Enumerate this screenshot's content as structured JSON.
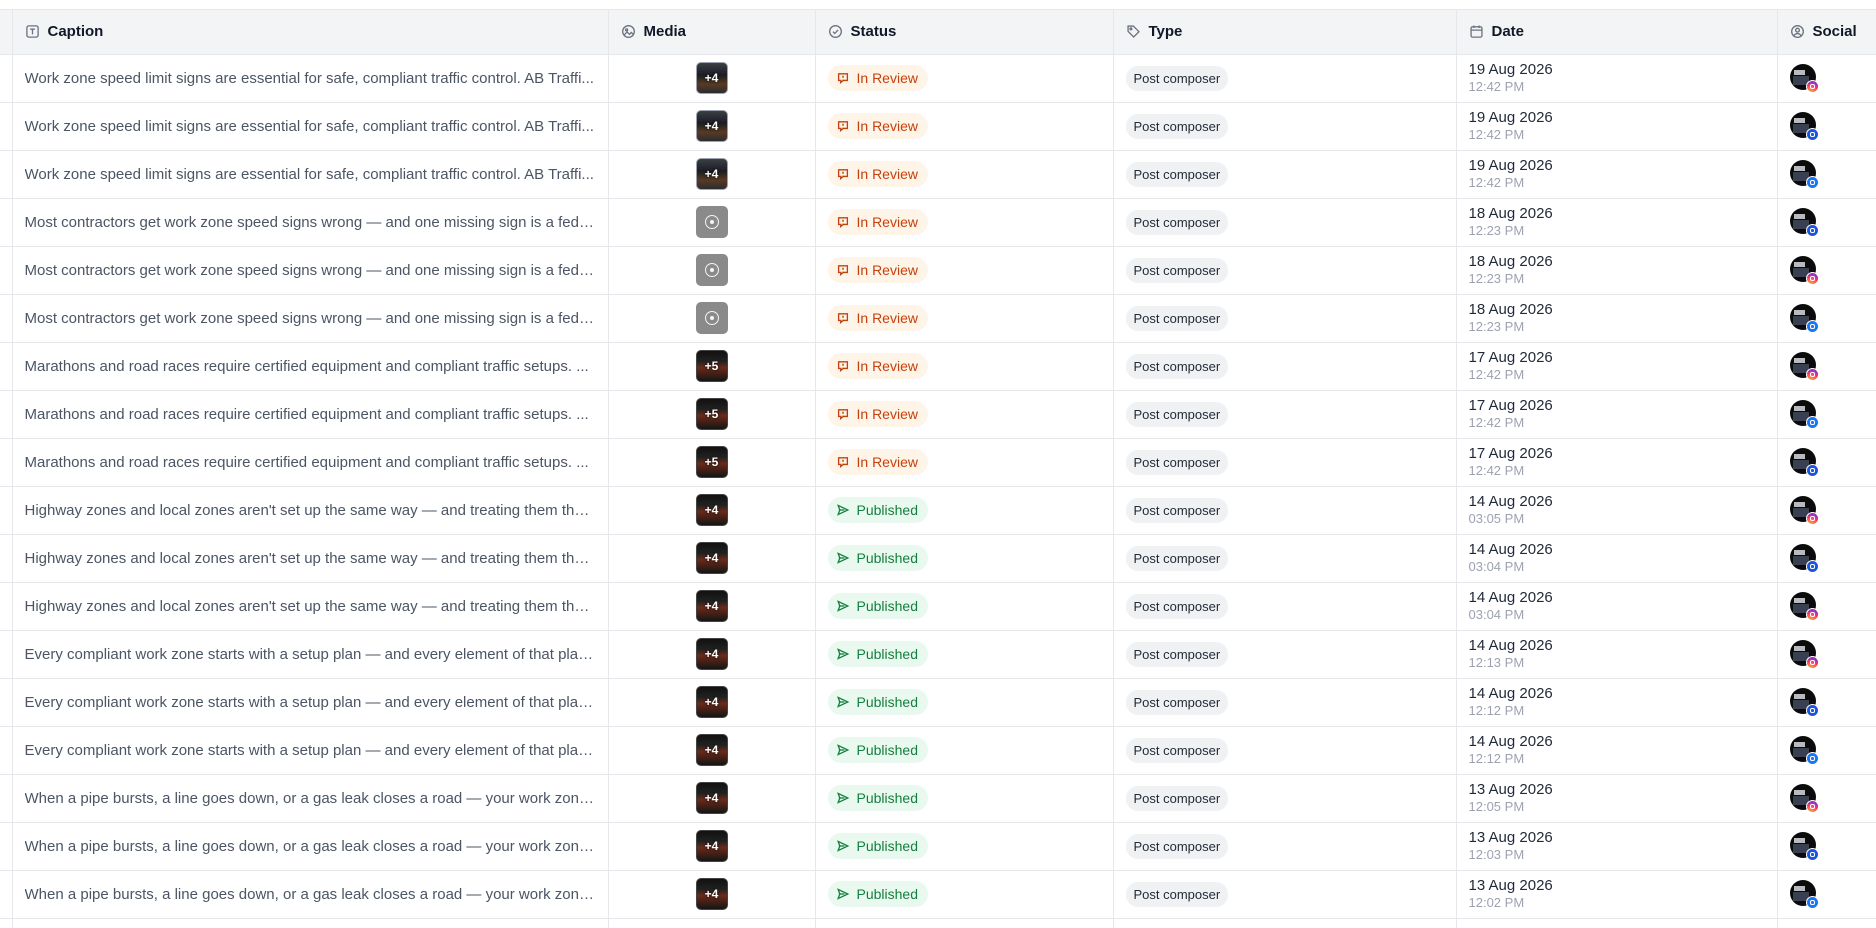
{
  "columns": [
    {
      "key": "caption",
      "label": "Caption",
      "icon": "text-icon"
    },
    {
      "key": "media",
      "label": "Media",
      "icon": "image-icon"
    },
    {
      "key": "status",
      "label": "Status",
      "icon": "check-circle-icon"
    },
    {
      "key": "type",
      "label": "Type",
      "icon": "tag-icon"
    },
    {
      "key": "date",
      "label": "Date",
      "icon": "calendar-icon"
    },
    {
      "key": "social",
      "label": "Social",
      "icon": "user-circle-icon"
    }
  ],
  "colors": {
    "review_text": "#c2410c",
    "review_bg": "#fff4e8",
    "published_text": "#15803d",
    "published_bg": "#e9f9ef"
  },
  "rows": [
    {
      "caption": "Work zone speed limit signs are essential for safe, compliant traffic control. AB Traffi...",
      "media": "+4",
      "media_kind": "image",
      "status": "In Review",
      "status_kind": "review",
      "type": "Post composer",
      "date": "19 Aug 2026",
      "time": "12:42 PM",
      "social": "instagram"
    },
    {
      "caption": "Work zone speed limit signs are essential for safe, compliant traffic control. AB Traffi...",
      "media": "+4",
      "media_kind": "image",
      "status": "In Review",
      "status_kind": "review",
      "type": "Post composer",
      "date": "19 Aug 2026",
      "time": "12:42 PM",
      "social": "gbp"
    },
    {
      "caption": "Work zone speed limit signs are essential for safe, compliant traffic control. AB Traffi...",
      "media": "+4",
      "media_kind": "image",
      "status": "In Review",
      "status_kind": "review",
      "type": "Post composer",
      "date": "19 Aug 2026",
      "time": "12:42 PM",
      "social": "facebook"
    },
    {
      "caption": "Most contractors get work zone speed signs wrong — and one missing sign is a fede...",
      "media": "",
      "media_kind": "video",
      "status": "In Review",
      "status_kind": "review",
      "type": "Post composer",
      "date": "18 Aug 2026",
      "time": "12:23 PM",
      "social": "gbp"
    },
    {
      "caption": "Most contractors get work zone speed signs wrong — and one missing sign is a fede...",
      "media": "",
      "media_kind": "video",
      "status": "In Review",
      "status_kind": "review",
      "type": "Post composer",
      "date": "18 Aug 2026",
      "time": "12:23 PM",
      "social": "instagram"
    },
    {
      "caption": "Most contractors get work zone speed signs wrong — and one missing sign is a fede...",
      "media": "",
      "media_kind": "video",
      "status": "In Review",
      "status_kind": "review",
      "type": "Post composer",
      "date": "18 Aug 2026",
      "time": "12:23 PM",
      "social": "facebook"
    },
    {
      "caption": "Marathons and road races require certified equipment and compliant traffic setups. ...",
      "media": "+5",
      "media_kind": "image-dark",
      "status": "In Review",
      "status_kind": "review",
      "type": "Post composer",
      "date": "17 Aug 2026",
      "time": "12:42 PM",
      "social": "instagram"
    },
    {
      "caption": "Marathons and road races require certified equipment and compliant traffic setups. ...",
      "media": "+5",
      "media_kind": "image-dark",
      "status": "In Review",
      "status_kind": "review",
      "type": "Post composer",
      "date": "17 Aug 2026",
      "time": "12:42 PM",
      "social": "facebook"
    },
    {
      "caption": "Marathons and road races require certified equipment and compliant traffic setups. ...",
      "media": "+5",
      "media_kind": "image-dark",
      "status": "In Review",
      "status_kind": "review",
      "type": "Post composer",
      "date": "17 Aug 2026",
      "time": "12:42 PM",
      "social": "gbp"
    },
    {
      "caption": "Highway zones and local zones aren't set up the same way — and treating them the s...",
      "media": "+4",
      "media_kind": "image-dark",
      "status": "Published",
      "status_kind": "published",
      "type": "Post composer",
      "date": "14 Aug 2026",
      "time": "03:05 PM",
      "social": "instagram"
    },
    {
      "caption": "Highway zones and local zones aren't set up the same way — and treating them the s...",
      "media": "+4",
      "media_kind": "image-dark",
      "status": "Published",
      "status_kind": "published",
      "type": "Post composer",
      "date": "14 Aug 2026",
      "time": "03:04 PM",
      "social": "gbp"
    },
    {
      "caption": "Highway zones and local zones aren't set up the same way — and treating them the s...",
      "media": "+4",
      "media_kind": "image-dark",
      "status": "Published",
      "status_kind": "published",
      "type": "Post composer",
      "date": "14 Aug 2026",
      "time": "03:04 PM",
      "social": "instagram"
    },
    {
      "caption": "Every compliant work zone starts with a setup plan — and every element of that plan ...",
      "media": "+4",
      "media_kind": "image-dark",
      "status": "Published",
      "status_kind": "published",
      "type": "Post composer",
      "date": "14 Aug 2026",
      "time": "12:13 PM",
      "social": "instagram"
    },
    {
      "caption": "Every compliant work zone starts with a setup plan — and every element of that plan ...",
      "media": "+4",
      "media_kind": "image-dark",
      "status": "Published",
      "status_kind": "published",
      "type": "Post composer",
      "date": "14 Aug 2026",
      "time": "12:12 PM",
      "social": "gbp"
    },
    {
      "caption": "Every compliant work zone starts with a setup plan — and every element of that plan ...",
      "media": "+4",
      "media_kind": "image-dark",
      "status": "Published",
      "status_kind": "published",
      "type": "Post composer",
      "date": "14 Aug 2026",
      "time": "12:12 PM",
      "social": "facebook"
    },
    {
      "caption": "When a pipe bursts, a line goes down, or a gas leak closes a road — your work zone h...",
      "media": "+4",
      "media_kind": "image-dark",
      "status": "Published",
      "status_kind": "published",
      "type": "Post composer",
      "date": "13 Aug 2026",
      "time": "12:05 PM",
      "social": "instagram"
    },
    {
      "caption": "When a pipe bursts, a line goes down, or a gas leak closes a road — your work zone h...",
      "media": "+4",
      "media_kind": "image-dark",
      "status": "Published",
      "status_kind": "published",
      "type": "Post composer",
      "date": "13 Aug 2026",
      "time": "12:03 PM",
      "social": "gbp"
    },
    {
      "caption": "When a pipe bursts, a line goes down, or a gas leak closes a road — your work zone h...",
      "media": "+4",
      "media_kind": "image-dark",
      "status": "Published",
      "status_kind": "published",
      "type": "Post composer",
      "date": "13 Aug 2026",
      "time": "12:02 PM",
      "social": "facebook"
    }
  ]
}
